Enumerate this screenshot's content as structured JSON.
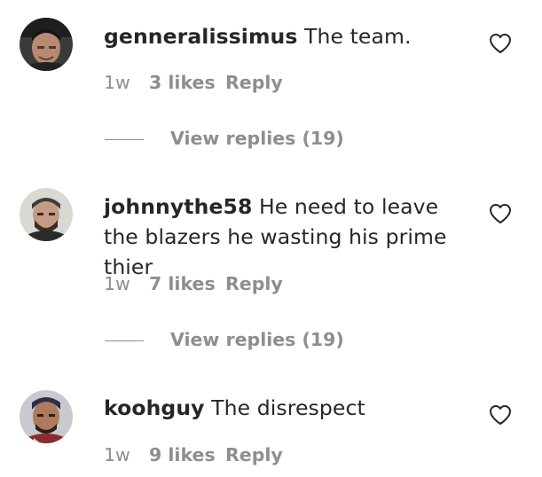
{
  "comments": [
    {
      "username": "genneralissimus",
      "text": "The team.",
      "age": "1w",
      "likes": "3 likes",
      "reply_label": "Reply",
      "view_replies": "View replies (19)",
      "avatar_icon": "user-avatar"
    },
    {
      "username": "johnnythe58",
      "text": "He need to leave the blazers he wasting his prime thier",
      "age": "1w",
      "likes": "7 likes",
      "reply_label": "Reply",
      "view_replies": "View replies (19)",
      "avatar_icon": "user-avatar"
    },
    {
      "username": "koohguy",
      "text": "The disrespect",
      "age": "1w",
      "likes": "9 likes",
      "reply_label": "Reply",
      "avatar_icon": "user-avatar"
    }
  ],
  "icons": {
    "like": "heart-outline-icon"
  },
  "colors": {
    "text_primary": "#262626",
    "text_secondary": "#8e8e8e",
    "background": "#ffffff"
  }
}
